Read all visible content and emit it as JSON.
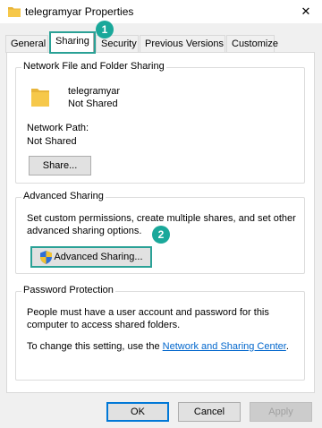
{
  "window": {
    "title": "telegramyar Properties",
    "close_glyph": "✕",
    "folder_color": "#f6c84a"
  },
  "tabs": [
    {
      "label": "General"
    },
    {
      "label": "Sharing"
    },
    {
      "label": "Security"
    },
    {
      "label": "Previous Versions"
    },
    {
      "label": "Customize"
    }
  ],
  "network_sharing": {
    "group_title": "Network File and Folder Sharing",
    "folder_name": "telegramyar",
    "share_status": "Not Shared",
    "path_label": "Network Path:",
    "path_value": "Not Shared",
    "share_button": "Share..."
  },
  "advanced_sharing": {
    "group_title": "Advanced Sharing",
    "description_line1": "Set custom permissions, create multiple shares, and set other",
    "description_line2": "advanced sharing options.",
    "button_label": "Advanced Sharing..."
  },
  "password_protection": {
    "group_title": "Password Protection",
    "line1": "People must have a user account and password for this",
    "line2": "computer to access shared folders.",
    "change_prefix": "To change this setting, use the ",
    "link_text": "Network and Sharing Center",
    "change_suffix": "."
  },
  "annotations": {
    "step1": "1",
    "step2": "2",
    "highlight_color": "#2aa196"
  },
  "footer": {
    "ok": "OK",
    "cancel": "Cancel",
    "apply": "Apply"
  }
}
